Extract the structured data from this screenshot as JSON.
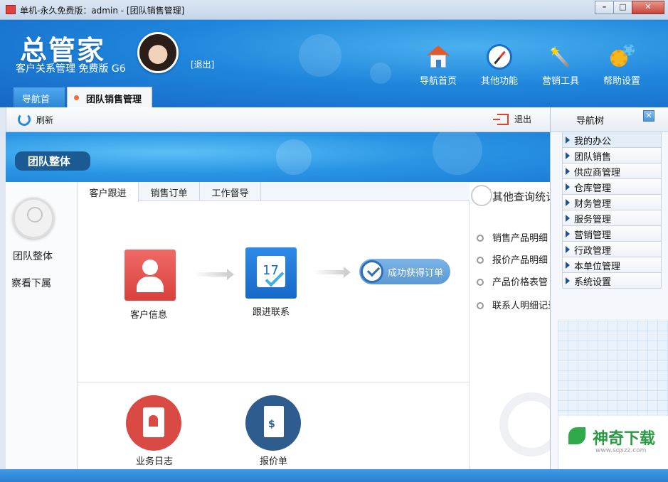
{
  "window": {
    "title": "单机-永久免费版：admin - [团队销售管理]",
    "controls": [
      "minimize",
      "maximize",
      "close"
    ]
  },
  "header": {
    "logo": "总管家",
    "subtitle": "客户关系管理 免费版 G6",
    "logout": "[退出]",
    "nav": [
      {
        "label": "导航首页",
        "icon": "home-icon"
      },
      {
        "label": "其他功能",
        "icon": "compass-icon"
      },
      {
        "label": "营销工具",
        "icon": "magic-wand-icon"
      },
      {
        "label": "帮助设置",
        "icon": "gear-icon"
      }
    ]
  },
  "tabs": [
    {
      "label": "导航首页",
      "active": false
    },
    {
      "label": "团队销售管理",
      "active": true
    }
  ],
  "toolbar": {
    "refresh": "刷新",
    "exit": "退出"
  },
  "banner": {
    "title": "团队整体"
  },
  "left_panel": {
    "items": [
      "团队整体",
      "察看下属"
    ]
  },
  "center": {
    "subtabs": [
      "客户跟进",
      "销售订单",
      "工作督导"
    ],
    "active_subtab": "客户跟进",
    "flow": {
      "step1": "客户信息",
      "step2": "跟进联系",
      "step3": "成功获得订单",
      "calendar_number": "17"
    },
    "bottom_items": [
      "业务日志",
      "报价单"
    ]
  },
  "query_panel": {
    "title": "其他查询统计",
    "items": [
      "销售产品明细",
      "报价产品明细",
      "产品价格表管",
      "联系人明细记录"
    ]
  },
  "nav_tree": {
    "title": "导航树",
    "items": [
      "我的办公",
      "团队销售",
      "供应商管理",
      "仓库管理",
      "财务管理",
      "服务管理",
      "营销管理",
      "行政管理",
      "本单位管理",
      "系统设置"
    ]
  },
  "watermark": {
    "text": "神奇下载",
    "url": "www.sqxzz.com"
  },
  "colors": {
    "header_blue": "#1f86dc",
    "accent_red": "#d9413c",
    "accent_blue": "#1769c8"
  }
}
